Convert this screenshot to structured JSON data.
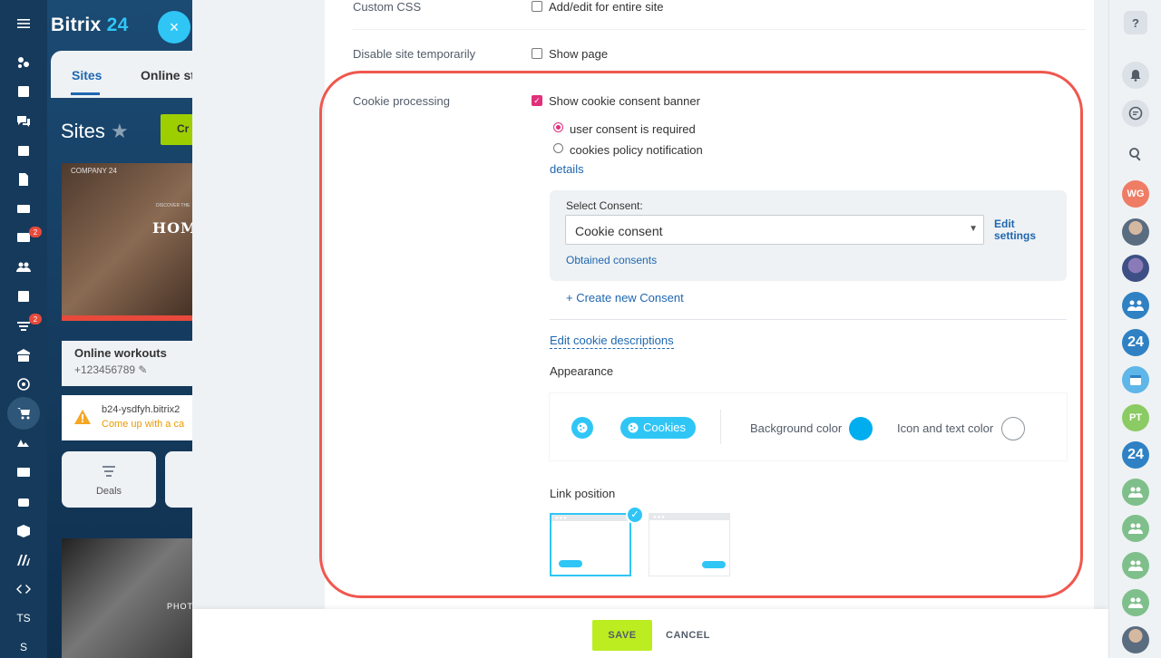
{
  "app": {
    "logo_text": "Bitrix",
    "logo_num": "24",
    "close": "×"
  },
  "leftnav": {
    "badge_mail": "2",
    "badge_filter": "2",
    "user_initials": "TS",
    "bottom_letter": "S"
  },
  "background": {
    "tabs": {
      "sites": "Sites",
      "online": "Online st"
    },
    "title": "Sites",
    "create_btn": "Cr",
    "thumb1_brand": "COMPANY 24",
    "thumb1_disc": "DISCOVER THE",
    "thumb1_heading": "HOM",
    "card_title": "Online workouts",
    "card_phone": "+123456789",
    "warn_url": "b24-ysdfyh.bitrix2",
    "warn_msg": "Come up with a ca",
    "deals_label": "Deals",
    "thumb2_label": "PHOTOG"
  },
  "form": {
    "custom_css": {
      "label": "Custom CSS",
      "option": "Add/edit for entire site",
      "checked": false
    },
    "disable_site": {
      "label": "Disable site temporarily",
      "option": "Show page",
      "checked": false
    },
    "cookie": {
      "label": "Cookie processing",
      "show_banner": "Show cookie consent banner",
      "show_banner_checked": true,
      "radio_required": "user consent is required",
      "radio_notify": "cookies policy notification",
      "details": "details",
      "select_label": "Select Consent:",
      "select_value": "Cookie consent",
      "edit_settings_1": "Edit",
      "edit_settings_2": "settings",
      "obtained": "Obtained consents",
      "create_new": "+ Create new Consent",
      "edit_descriptions": "Edit cookie descriptions",
      "appearance": "Appearance",
      "cookies_pill": "Cookies",
      "bg_color_label": "Background color",
      "bg_color": "#00aeef",
      "text_color_label": "Icon and text color",
      "text_color": "#ffffff",
      "link_position": "Link position",
      "link_position_selected": "left"
    }
  },
  "footer": {
    "save": "SAVE",
    "cancel": "CANCEL"
  },
  "rightbar": {
    "help": "?",
    "avatars": [
      {
        "initials": "WG",
        "color": "#ef7c64"
      },
      {
        "initials": "PT",
        "color": "#8bcb63"
      },
      {
        "initials": "24",
        "color": "#2f81c4"
      }
    ]
  },
  "colors": {
    "accent": "#2fc6f6",
    "brand_dark": "#163a5b",
    "checkbox_pink": "#e0307c",
    "save_green": "#bbed21",
    "highlight": "#f0574e"
  }
}
